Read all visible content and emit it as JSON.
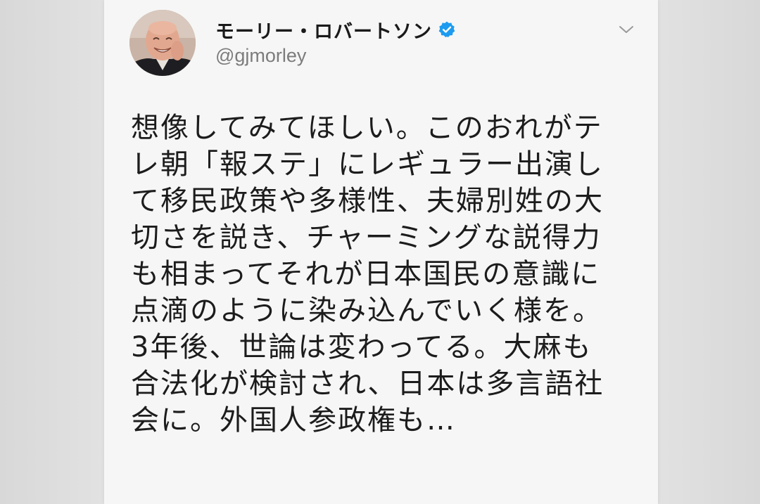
{
  "tweet": {
    "author": {
      "display_name": "モーリー・ロバートソン",
      "handle": "@gjmorley",
      "verified": true
    },
    "menu_icon": "chevron-down-icon",
    "text_lines": [
      "想像してみてほしい。このおれがテ",
      "レ朝「報ステ」にレギュラー出演し",
      "て移民政策や多様性、夫婦別姓の大",
      "切さを説き、チャーミングな説得力",
      "も相まってそれが日本国民の意識に",
      "点滴のように染み込んでいく様を。",
      "3年後、世論は変わってる。大麻も",
      "合法化が検討され、日本は多言語社",
      "会に。外国人参政権も…"
    ]
  },
  "colors": {
    "verified_badge": "#1d9bf0",
    "text": "#1c1c1c",
    "handle": "#7c7c7c",
    "card_background": "#f6f6f6"
  }
}
